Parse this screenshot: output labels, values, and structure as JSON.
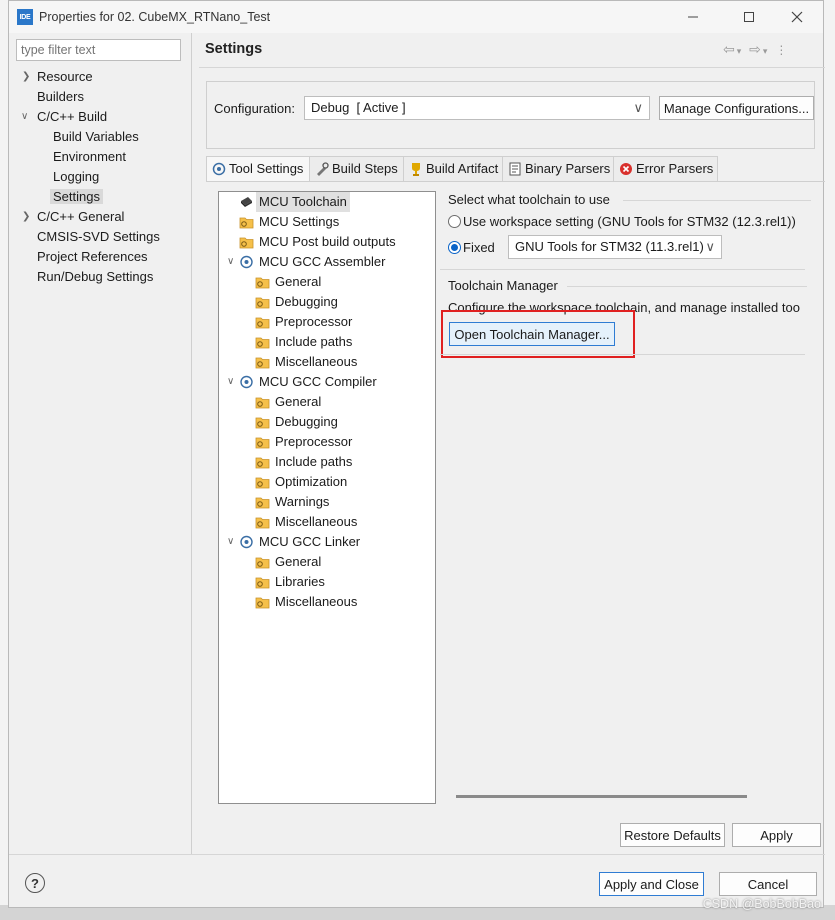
{
  "window": {
    "app_icon_label": "IDE",
    "title": "Properties for 02. CubeMX_RTNano_Test"
  },
  "left": {
    "filter_placeholder": "type filter text",
    "items": [
      {
        "label": "Resource"
      },
      {
        "label": "Builders"
      },
      {
        "label": "C/C++ Build"
      },
      {
        "label": "Build Variables"
      },
      {
        "label": "Environment"
      },
      {
        "label": "Logging"
      },
      {
        "label": "Settings"
      },
      {
        "label": "C/C++ General"
      },
      {
        "label": "CMSIS-SVD Settings"
      },
      {
        "label": "Project References"
      },
      {
        "label": "Run/Debug Settings"
      }
    ]
  },
  "header": {
    "title": "Settings"
  },
  "config": {
    "label": "Configuration:",
    "value": "Debug  [ Active ]",
    "manage_button": "Manage Configurations..."
  },
  "tabs": [
    {
      "label": "Tool Settings",
      "icon": "tool-settings-icon"
    },
    {
      "label": "Build Steps",
      "icon": "build-steps-icon"
    },
    {
      "label": "Build Artifact",
      "icon": "trophy-icon"
    },
    {
      "label": "Binary Parsers",
      "icon": "binary-parsers-icon"
    },
    {
      "label": "Error Parsers",
      "icon": "error-icon"
    }
  ],
  "settings_tree": [
    {
      "label": "MCU Toolchain"
    },
    {
      "label": "MCU Settings"
    },
    {
      "label": "MCU Post build outputs"
    },
    {
      "label": "MCU GCC Assembler"
    },
    {
      "label": "General"
    },
    {
      "label": "Debugging"
    },
    {
      "label": "Preprocessor"
    },
    {
      "label": "Include paths"
    },
    {
      "label": "Miscellaneous"
    },
    {
      "label": "MCU GCC Compiler"
    },
    {
      "label": "General"
    },
    {
      "label": "Debugging"
    },
    {
      "label": "Preprocessor"
    },
    {
      "label": "Include paths"
    },
    {
      "label": "Optimization"
    },
    {
      "label": "Warnings"
    },
    {
      "label": "Miscellaneous"
    },
    {
      "label": "MCU GCC Linker"
    },
    {
      "label": "General"
    },
    {
      "label": "Libraries"
    },
    {
      "label": "Miscellaneous"
    }
  ],
  "toolchain": {
    "select_label": "Select what toolchain to use",
    "workspace_option": "Use workspace setting (GNU Tools for STM32 (12.3.rel1))",
    "fixed_option": "Fixed",
    "fixed_value": "GNU Tools for STM32 (11.3.rel1)",
    "selected": "fixed",
    "manager_title": "Toolchain Manager",
    "manager_desc": "Configure the workspace toolchain, and manage installed too",
    "manager_button": "Open Toolchain Manager...",
    "highlight_color": "#e02020"
  },
  "buttons": {
    "restore": "Restore Defaults",
    "apply": "Apply",
    "apply_close": "Apply and Close",
    "cancel": "Cancel",
    "help": "?"
  },
  "watermark": "CSDN @BobBobBao"
}
